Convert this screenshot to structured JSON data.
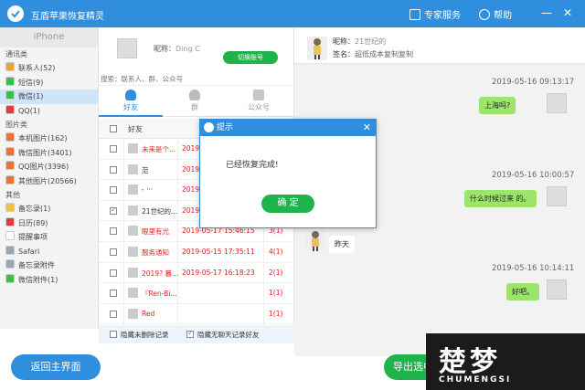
{
  "titlebar": {
    "title": "互盾苹果恢复精灵",
    "service": "专家服务",
    "help": "帮助",
    "minimize": "—",
    "close": "✕"
  },
  "sidebar": {
    "device": "iPhone",
    "sections": [
      {
        "label": "通讯类",
        "items": [
          {
            "label": "联系人(52)",
            "icon_color": "#e8a33a"
          },
          {
            "label": "短信(9)",
            "icon_color": "#33c24a"
          },
          {
            "label": "微信(1)",
            "icon_color": "#33c24a",
            "active": true
          },
          {
            "label": "QQ(1)",
            "icon_color": "#e63b3b"
          }
        ]
      },
      {
        "label": "图片类",
        "items": [
          {
            "label": "本机图片(162)",
            "icon_color": "#e8743a"
          },
          {
            "label": "微信图片(3401)",
            "icon_color": "#e8743a"
          },
          {
            "label": "QQ图片(3396)",
            "icon_color": "#e8743a"
          },
          {
            "label": "其他图片(20566)",
            "icon_color": "#e8743a"
          }
        ]
      },
      {
        "label": "其他",
        "items": [
          {
            "label": "备忘录(1)",
            "icon_color": "#f1c232"
          },
          {
            "label": "日历(89)",
            "icon_color": "#e63b3b"
          },
          {
            "label": "提醒事项",
            "icon_color": "#ffffff"
          },
          {
            "label": "Safari",
            "icon_color": "#9aa6b2"
          },
          {
            "label": "备忘录附件",
            "icon_color": "#9aa6b2"
          },
          {
            "label": "微信附件(1)",
            "icon_color": "#33c24a"
          }
        ]
      }
    ]
  },
  "middle": {
    "nickname": "昵称：",
    "nickname_value": "Ding C",
    "switch_button": "切换账号",
    "search_placeholder": "搜索：联系人、群、公众号",
    "tabs": [
      "好友",
      "群",
      "公众号"
    ],
    "column_header": "好友",
    "rows": [
      {
        "name": "未来是个...",
        "time": "2019-",
        "count": "",
        "checked": false,
        "red": true
      },
      {
        "name": "范",
        "time": "2019-",
        "count": "",
        "checked": false,
        "red": false
      },
      {
        "name": "- ···",
        "time": "2019-",
        "count": "",
        "checked": false,
        "red": false
      },
      {
        "name": "21世纪的...",
        "time": "2019-",
        "count": "",
        "checked": true,
        "red": false
      },
      {
        "name": "眼里有光",
        "time": "2019-05-17 15:46:15",
        "count": "3(1)",
        "checked": false,
        "red": true
      },
      {
        "name": "服务通知",
        "time": "2019-05-15 17:35:11",
        "count": "4(1)",
        "checked": false,
        "red": true
      },
      {
        "name": "2019? 暮...",
        "time": "2019-05-17 16:18:23",
        "count": "2(1)",
        "checked": false,
        "red": true
      },
      {
        "name": "『Ren-Bi...",
        "time": "",
        "count": "1(1)",
        "checked": false,
        "red": true
      },
      {
        "name": "Red",
        "time": "",
        "count": "1(1)",
        "checked": false,
        "red": true
      }
    ],
    "footer_hide_deleted": "隐藏未删除记录",
    "footer_hide_no_chat": "隐藏无聊天记录好友"
  },
  "chat": {
    "nickname_label": "昵称：",
    "nickname_value": "21世纪的",
    "signature_label": "签名：",
    "signature_value": "超低成本复制复制",
    "messages": [
      {
        "time": "2019-05-16 09:13:17",
        "text": "上海吗?",
        "side": "right"
      },
      {
        "time": "2019-05-16 10:00:57",
        "text": "什么时候过来 的。",
        "side": "right"
      },
      {
        "time": "",
        "text": "昨天",
        "side": "left"
      },
      {
        "time": "2019-05-16 10:14:11",
        "text": "好吧。",
        "side": "right"
      }
    ]
  },
  "dialog": {
    "title": "提示",
    "message": "已经恢复完成!",
    "ok": "确 定",
    "close": "✕"
  },
  "buttons": {
    "back": "返回主界面",
    "export": "导出选中记录"
  },
  "watermark": {
    "big": "楚梦",
    "small": "CHUMENGSI"
  },
  "colors": {
    "primary": "#2f8fde",
    "green": "#1fb34b",
    "bubble": "#9ce56c",
    "red": "#e02020"
  }
}
